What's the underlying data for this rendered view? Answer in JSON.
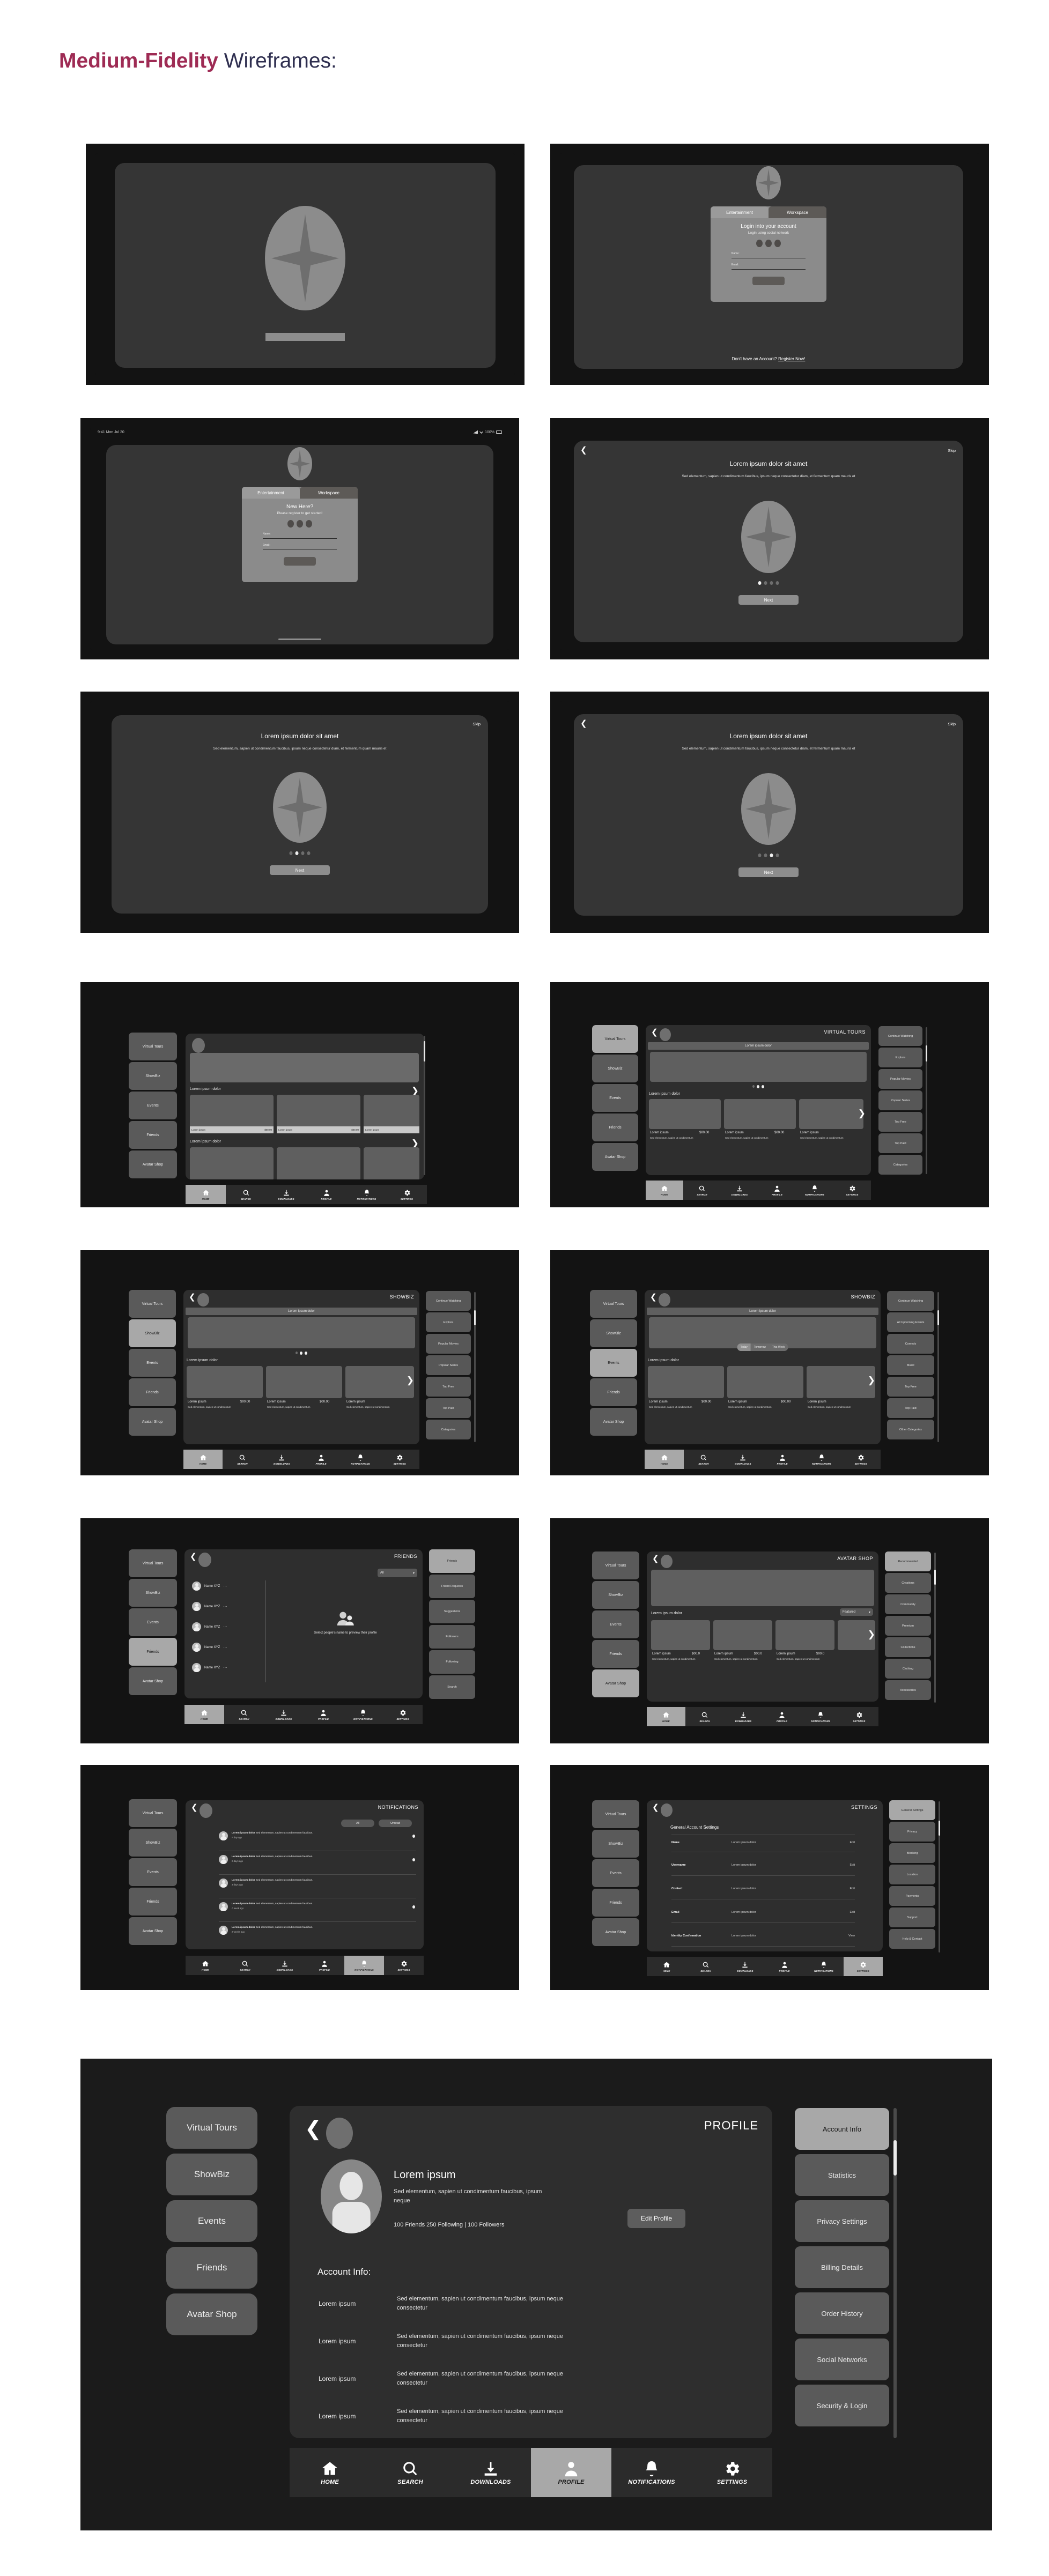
{
  "title": {
    "bold": "Medium-Fidelity",
    "plain": "Wireframes:"
  },
  "statusbar": {
    "time": "9:41 Mon Jul 20",
    "battery": "100%"
  },
  "auth": {
    "tabs": [
      "Entertainment",
      "Workspace"
    ],
    "login": {
      "heading": "Login into your account",
      "sub": "Login using social network"
    },
    "register": {
      "heading": "New Here?",
      "sub": "Please register to get started!"
    },
    "fields": [
      {
        "label": "Name:"
      },
      {
        "label": "Email:"
      }
    ],
    "register_prompt": "Don't have an Account? ",
    "register_link": "Register Now!"
  },
  "onboarding": {
    "heading": "Lorem ipsum dolor sit amet",
    "body": "Sed elementum, sapien ut condimentum faucibus, ipsum neque consectetur diam, et fermentum quam mauris et",
    "skip": "Skip",
    "next": "Next",
    "dots_total": 4,
    "screens": [
      {
        "active_dot": 0,
        "has_back": true
      },
      {
        "active_dot": 1,
        "has_back": false
      },
      {
        "active_dot": 2,
        "has_back": true
      }
    ]
  },
  "sidebar": {
    "items": [
      "Virtual Tours",
      "ShowBiz",
      "Events",
      "Friends",
      "Avatar Shop"
    ]
  },
  "bottom_nav": {
    "items": [
      {
        "label": "HOME",
        "icon": "home-icon"
      },
      {
        "label": "SEARCH",
        "icon": "search-icon"
      },
      {
        "label": "DOWNLOADS",
        "icon": "download-icon"
      },
      {
        "label": "PROFILE",
        "icon": "person-icon"
      },
      {
        "label": "NOTIFICATIONS",
        "icon": "bell-icon"
      },
      {
        "label": "SETTINGS",
        "icon": "gear-icon"
      }
    ]
  },
  "common": {
    "row_label": "Lorem ipsum dolor",
    "card_name": "Lorem ipsum",
    "card_price": "$00.00",
    "card_price_short": "$00.0",
    "card_desc": "Sed elementum, sapien ut condimentum faucibus, ipsum neque consectetur",
    "card_desc_short": "Sed elementum, sapien ut condimentum"
  },
  "screens": {
    "home": {
      "active_nav": "HOME"
    },
    "virtual_tours": {
      "title": "VIRTUAL TOURS",
      "active_side": "Virtual Tours",
      "panel": [
        "Continue Watching",
        "Explore",
        "Popular Movies",
        "Popular Series",
        "Top Free",
        "Top Paid",
        "Categories"
      ]
    },
    "showbiz": {
      "title": "SHOWBIZ",
      "active_side": "ShowBiz",
      "panel": [
        "Continue Watching",
        "Explore",
        "Popular Movies",
        "Popular Series",
        "Top Free",
        "Top Paid",
        "Categories"
      ]
    },
    "events": {
      "title": "SHOWBIZ",
      "active_side": "Events",
      "segments": [
        "Today",
        "Tomorrow",
        "This Week"
      ],
      "active_segment": "Today",
      "panel": [
        "Continue Watching",
        "All Upcoming Events",
        "Comedy",
        "Music",
        "Top Free",
        "Top Paid",
        "Other Categories"
      ]
    },
    "friends": {
      "title": "FRIENDS",
      "active_side": "Friends",
      "filter": "All",
      "people": [
        "Name XYZ",
        "Name XYZ",
        "Name XYZ",
        "Name XYZ",
        "Name XYZ"
      ],
      "empty_text": "Select people's name to preview their profile",
      "panel": [
        "Friends",
        "Friend Requests",
        "Suggestions",
        "Followers",
        "Following",
        "Search"
      ]
    },
    "avatar_shop": {
      "title": "AVATAR SHOP",
      "active_side": "Avatar Shop",
      "filter": "Featured",
      "panel": [
        "Recommended",
        "Creations",
        "Community",
        "Premium",
        "Collections",
        "Clothing",
        "Accessories"
      ]
    },
    "notifications": {
      "title": "NOTIFICATIONS",
      "active_nav": "NOTIFICATIONS",
      "tabs": [
        "All",
        "Unread"
      ],
      "items": [
        {
          "title": "Lorem ipsum dolor",
          "body": "Sed elementum, sapien ut condimentum faucibus.",
          "time": "A day ago",
          "unread": true
        },
        {
          "title": "Lorem ipsum dolor",
          "body": "Sed elementum, sapien ut condimentum faucibus.",
          "time": "2 days ago",
          "unread": true
        },
        {
          "title": "Lorem ipsum dolor",
          "body": "Sed elementum, sapien ut condimentum faucibus.",
          "time": "3 days ago",
          "unread": false
        },
        {
          "title": "Lorem ipsum dolor",
          "body": "Sed elementum, sapien ut condimentum faucibus.",
          "time": "A week ago",
          "unread": true
        },
        {
          "title": "Lorem ipsum dolor",
          "body": "Sed elementum, sapien ut condimentum faucibus.",
          "time": "2 weeks ago",
          "unread": false
        }
      ]
    },
    "settings": {
      "title": "SETTINGS",
      "active_nav": "SETTINGS",
      "section": "General Account Settings",
      "rows": [
        {
          "key": "Name",
          "value": "Lorem ipsum dolor",
          "action": "Edit"
        },
        {
          "key": "Username",
          "value": "Lorem ipsum dolor",
          "action": "Edit"
        },
        {
          "key": "Contact",
          "value": "Lorem ipsum dolor",
          "action": "Edit"
        },
        {
          "key": "Email",
          "value": "Lorem ipsum dolor",
          "action": "Edit"
        },
        {
          "key": "Identity Confirmation",
          "value": "Lorem ipsum dolor",
          "action": "View"
        }
      ],
      "panel": [
        "General Settings",
        "Privacy",
        "Blocking",
        "Location",
        "Payments",
        "Support",
        "Help & Contact"
      ]
    },
    "profile": {
      "title": "PROFILE",
      "active_nav": "PROFILE",
      "name": "Lorem ipsum",
      "bio": "Sed elementum, sapien ut condimentum faucibus, ipsum neque",
      "stats": "100 Friends   250 Following | 100 Followers",
      "edit_button": "Edit Profile",
      "account_info_heading": "Account Info:",
      "rows": [
        {
          "key": "Lorem ipsum",
          "value": "Sed elementum, sapien ut condimentum faucibus, ipsum neque consectetur"
        },
        {
          "key": "Lorem ipsum",
          "value": "Sed elementum, sapien ut condimentum faucibus, ipsum neque consectetur"
        },
        {
          "key": "Lorem ipsum",
          "value": "Sed elementum, sapien ut condimentum faucibus, ipsum neque consectetur"
        },
        {
          "key": "Lorem ipsum",
          "value": "Sed elementum, sapien ut condimentum faucibus, ipsum neque consectetur"
        }
      ],
      "panel": [
        "Account Info",
        "Statistics",
        "Privacy Settings",
        "Billing Details",
        "Order History",
        "Social Networks",
        "Security & Login"
      ]
    }
  },
  "colors": {
    "accent": "#9e2b54",
    "ink": "#2e2e4f",
    "frame": "#131313",
    "surface": "#2e2e2e",
    "chip": "#5a5a5a"
  }
}
